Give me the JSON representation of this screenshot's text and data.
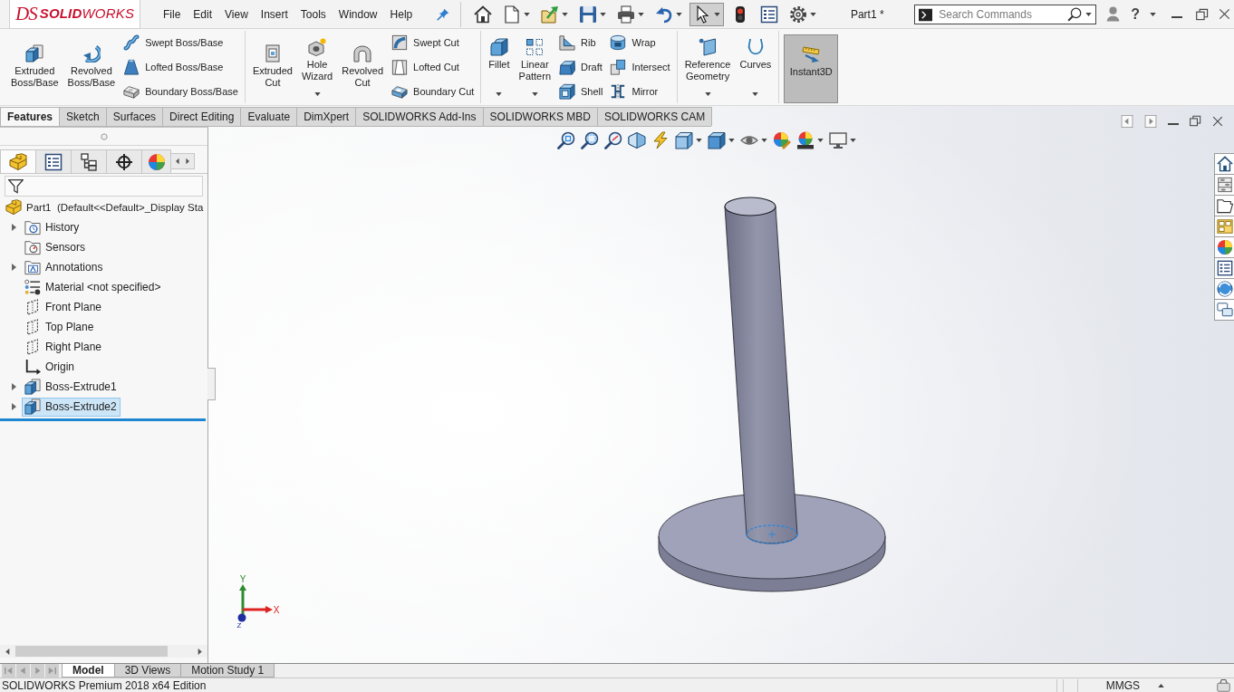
{
  "logo": {
    "mark": "DS",
    "text": "**SOLID**WORKS"
  },
  "menu": [
    "File",
    "Edit",
    "View",
    "Insert",
    "Tools",
    "Window",
    "Help"
  ],
  "quick_access": [
    {
      "kind": "home",
      "dropdown": false,
      "selected": false
    },
    {
      "kind": "new",
      "dropdown": true,
      "selected": false
    },
    {
      "kind": "open",
      "dropdown": true,
      "selected": false
    },
    {
      "kind": "save",
      "dropdown": true,
      "selected": false
    },
    {
      "kind": "print",
      "dropdown": true,
      "selected": false
    },
    {
      "kind": "undo",
      "dropdown": true,
      "selected": false
    },
    {
      "kind": "select",
      "dropdown": true,
      "selected": true
    },
    {
      "kind": "rebuild",
      "dropdown": false,
      "selected": false
    },
    {
      "kind": "fileprops",
      "dropdown": false,
      "selected": false
    },
    {
      "kind": "options",
      "dropdown": true,
      "selected": false
    }
  ],
  "document_title": "Part1 *",
  "search": {
    "placeholder": "Search Commands"
  },
  "help_button": "?",
  "ribbon": {
    "groups": [
      {
        "large": [
          {
            "kind": "extrude",
            "label": "Extruded\nBoss/Base",
            "dropdown": false,
            "selected": false
          },
          {
            "kind": "revolve",
            "label": "Revolved\nBoss/Base",
            "dropdown": false,
            "selected": false
          }
        ],
        "stacks": [
          [
            {
              "kind": "sweep",
              "label": "Swept Boss/Base"
            },
            {
              "kind": "loft",
              "label": "Lofted Boss/Base"
            },
            {
              "kind": "boundary",
              "label": "Boundary Boss/Base"
            }
          ]
        ]
      },
      {
        "large": [
          {
            "kind": "extrudecut",
            "label": "Extruded\nCut",
            "dropdown": false,
            "selected": false
          },
          {
            "kind": "holewizard",
            "label": "Hole\nWizard",
            "dropdown": true,
            "selected": false
          },
          {
            "kind": "revolvecut",
            "label": "Revolved\nCut",
            "dropdown": false,
            "selected": false
          }
        ],
        "stacks": [
          [
            {
              "kind": "sweptcut",
              "label": "Swept Cut"
            },
            {
              "kind": "loftedcut",
              "label": "Lofted Cut"
            },
            {
              "kind": "boundarycut",
              "label": "Boundary Cut"
            }
          ]
        ]
      },
      {
        "large": [
          {
            "kind": "fillet",
            "label": "Fillet",
            "dropdown": true,
            "selected": false
          },
          {
            "kind": "pattern",
            "label": "Linear\nPattern",
            "dropdown": true,
            "selected": false
          }
        ],
        "stacks": [
          [
            {
              "kind": "rib",
              "label": "Rib"
            },
            {
              "kind": "draft",
              "label": "Draft"
            },
            {
              "kind": "shell",
              "label": "Shell"
            }
          ],
          [
            {
              "kind": "wrap",
              "label": "Wrap"
            },
            {
              "kind": "intersect",
              "label": "Intersect"
            },
            {
              "kind": "mirror",
              "label": "Mirror"
            }
          ]
        ]
      },
      {
        "large": [
          {
            "kind": "refgeometry",
            "label": "Reference\nGeometry",
            "dropdown": true,
            "selected": false
          },
          {
            "kind": "curves",
            "label": "Curves",
            "dropdown": true,
            "selected": false
          }
        ]
      },
      {
        "large": [
          {
            "kind": "instant3d",
            "label": "Instant3D",
            "dropdown": false,
            "selected": true
          }
        ]
      }
    ]
  },
  "command_tabs": [
    {
      "label": "Features",
      "selected": true
    },
    {
      "label": "Sketch",
      "selected": false
    },
    {
      "label": "Surfaces",
      "selected": false
    },
    {
      "label": "Direct Editing",
      "selected": false
    },
    {
      "label": "Evaluate",
      "selected": false
    },
    {
      "label": "DimXpert",
      "selected": false
    },
    {
      "label": "SOLIDWORKS Add-Ins",
      "selected": false
    },
    {
      "label": "SOLIDWORKS MBD",
      "selected": false
    },
    {
      "label": "SOLIDWORKS CAM",
      "selected": false
    }
  ],
  "feature_manager": {
    "tabs": [
      {
        "kind": "features",
        "selected": true
      },
      {
        "kind": "propertymanager",
        "selected": false
      },
      {
        "kind": "configurations",
        "selected": false
      },
      {
        "kind": "dimxpert",
        "selected": false
      },
      {
        "kind": "display",
        "selected": false
      }
    ],
    "root": {
      "label": "Part1  (Default<<Default>_Display Sta",
      "selected": false
    },
    "items": [
      {
        "kind": "history",
        "label": "History",
        "expanded": false,
        "selected": false
      },
      {
        "kind": "sensors",
        "label": "Sensors",
        "selected": false
      },
      {
        "kind": "annotations",
        "label": "Annotations",
        "expanded": false,
        "selected": false
      },
      {
        "kind": "material",
        "label": "Material <not specified>",
        "selected": false
      },
      {
        "kind": "plane",
        "label": "Front Plane",
        "selected": false
      },
      {
        "kind": "plane",
        "label": "Top Plane",
        "selected": false
      },
      {
        "kind": "plane",
        "label": "Right Plane",
        "selected": false
      },
      {
        "kind": "origin",
        "label": "Origin",
        "selected": false
      },
      {
        "kind": "feature",
        "label": "Boss-Extrude1",
        "expanded": false,
        "selected": false
      },
      {
        "kind": "feature",
        "label": "Boss-Extrude2",
        "expanded": false,
        "selected": true
      }
    ]
  },
  "viewport": {
    "triad": {
      "y": "Y",
      "x": "X",
      "z": "Z"
    }
  },
  "bottom_tabs": [
    {
      "label": "Model",
      "selected": true
    },
    {
      "label": "3D Views",
      "selected": false
    },
    {
      "label": "Motion Study 1",
      "selected": false
    }
  ],
  "status_bar": {
    "text": "SOLIDWORKS Premium 2018 x64 Edition",
    "units": "MMGS"
  }
}
